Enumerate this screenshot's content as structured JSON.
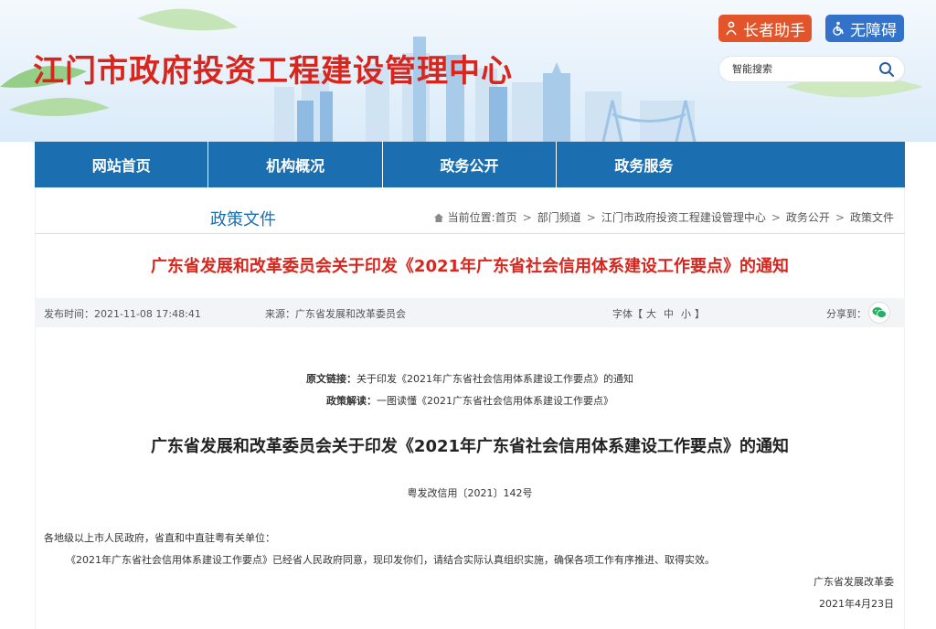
{
  "header": {
    "site_title": "江门市政府投资工程建设管理中心",
    "elder_label": "长者助手",
    "access_label": "无障碍",
    "search_placeholder": "智能搜索"
  },
  "nav": {
    "items": [
      {
        "label": "网站首页"
      },
      {
        "label": "机构概况"
      },
      {
        "label": "政务公开"
      },
      {
        "label": "政务服务"
      }
    ]
  },
  "category": {
    "title": "政策文件",
    "breadcrumb_prefix": "当前位置:",
    "breadcrumb": [
      "首页",
      "部门频道",
      "江门市政府投资工程建设管理中心",
      "政务公开",
      "政策文件"
    ],
    "separator": ">"
  },
  "article": {
    "title": "广东省发展和改革委员会关于印发《2021年广东省社会信用体系建设工作要点》的通知",
    "publish_time": "发布时间：2021-11-08 17:48:41",
    "source": "来源：广东省发展和改革委员会",
    "font_label": "字体【",
    "font_sizes": [
      "大",
      "中",
      "小"
    ],
    "font_close": "】",
    "share_label": "分享到：",
    "original_link_label": "原文链接：",
    "original_link_text": "关于印发《2021年广东省社会信用体系建设工作要点》的通知",
    "interpret_label": "政策解读：",
    "interpret_text": "一图读懂《2021广东省社会信用体系建设工作要点》",
    "doc_title": "广东省发展和改革委员会关于印发《2021年广东省社会信用体系建设工作要点》的通知",
    "doc_number": "粤发改信用〔2021〕142号",
    "recipients": "各地级以上市人民政府，省直和中直驻粤有关单位：",
    "body": "《2021年广东省社会信用体系建设工作要点》已经省人民政府同意，现印发你们，请结合实际认真组织实施，确保各项工作有序推进、取得实效。",
    "signature": "广东省发展改革委",
    "date": "2021年4月23日"
  },
  "colors": {
    "title_red": "#d7261e",
    "nav_blue": "#1b6fb0",
    "elder_orange": "#e2552b",
    "access_blue": "#3273c9",
    "wechat_green": "#2aae67"
  },
  "icons": {
    "elder": "elder-care-icon",
    "access": "wheelchair-icon",
    "search": "search-icon",
    "home": "home-icon",
    "share": "wechat-icon"
  }
}
